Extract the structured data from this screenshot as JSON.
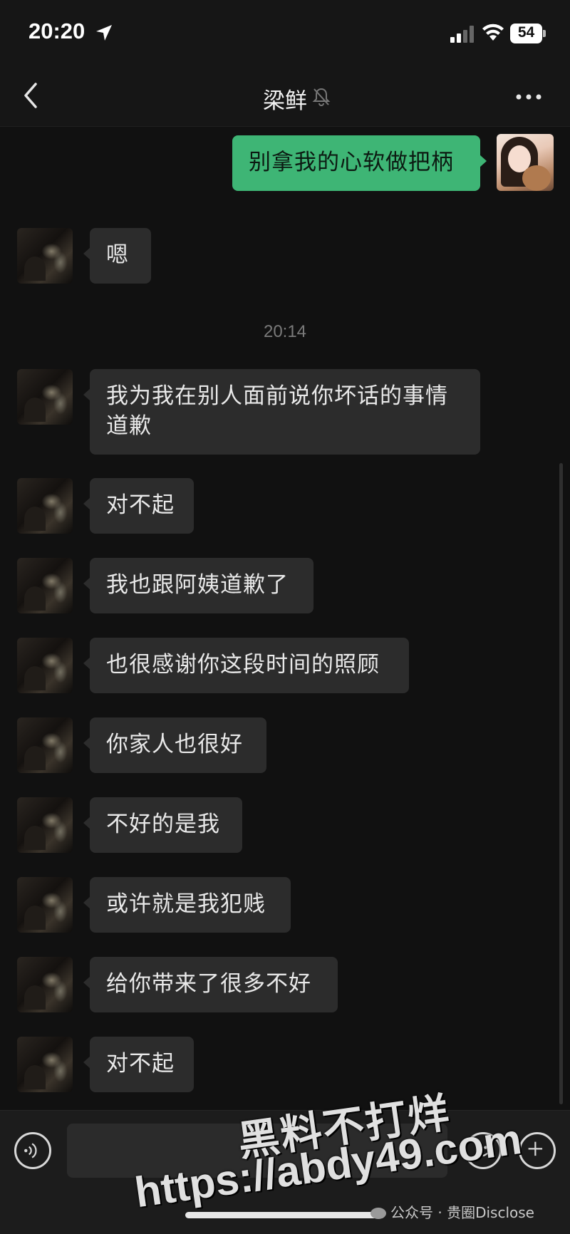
{
  "status_bar": {
    "time": "20:20",
    "battery": "54"
  },
  "nav": {
    "title": "梁鲜"
  },
  "messages": [
    {
      "side": "right",
      "text": "别拿我的心软做把柄"
    },
    {
      "side": "left",
      "text": "嗯"
    },
    {
      "type": "time",
      "text": "20:14"
    },
    {
      "side": "left",
      "text": "我为我在别人面前说你坏话的事情道歉"
    },
    {
      "side": "left",
      "text": "对不起"
    },
    {
      "side": "left",
      "text": "我也跟阿姨道歉了"
    },
    {
      "side": "left",
      "text": "也很感谢你这段时间的照顾"
    },
    {
      "side": "left",
      "text": "你家人也很好"
    },
    {
      "side": "left",
      "text": "不好的是我"
    },
    {
      "side": "left",
      "text": "或许就是我犯贱"
    },
    {
      "side": "left",
      "text": "给你带来了很多不好"
    },
    {
      "side": "left",
      "text": "对不起"
    }
  ],
  "watermark": {
    "line1": "黑料不打烊",
    "line2": "https://abdy49.com",
    "credit": "公众号 · 贵圈Disclose"
  },
  "icons": [
    "location-icon",
    "signal-icon",
    "wifi-icon",
    "back-chevron-icon",
    "mute-bell-icon",
    "more-dots-icon",
    "voice-icon",
    "emoji-icon",
    "plus-icon"
  ],
  "colors": {
    "background": "#111111",
    "bubble_self": "#3eb575",
    "bubble_other": "#2c2c2c"
  }
}
